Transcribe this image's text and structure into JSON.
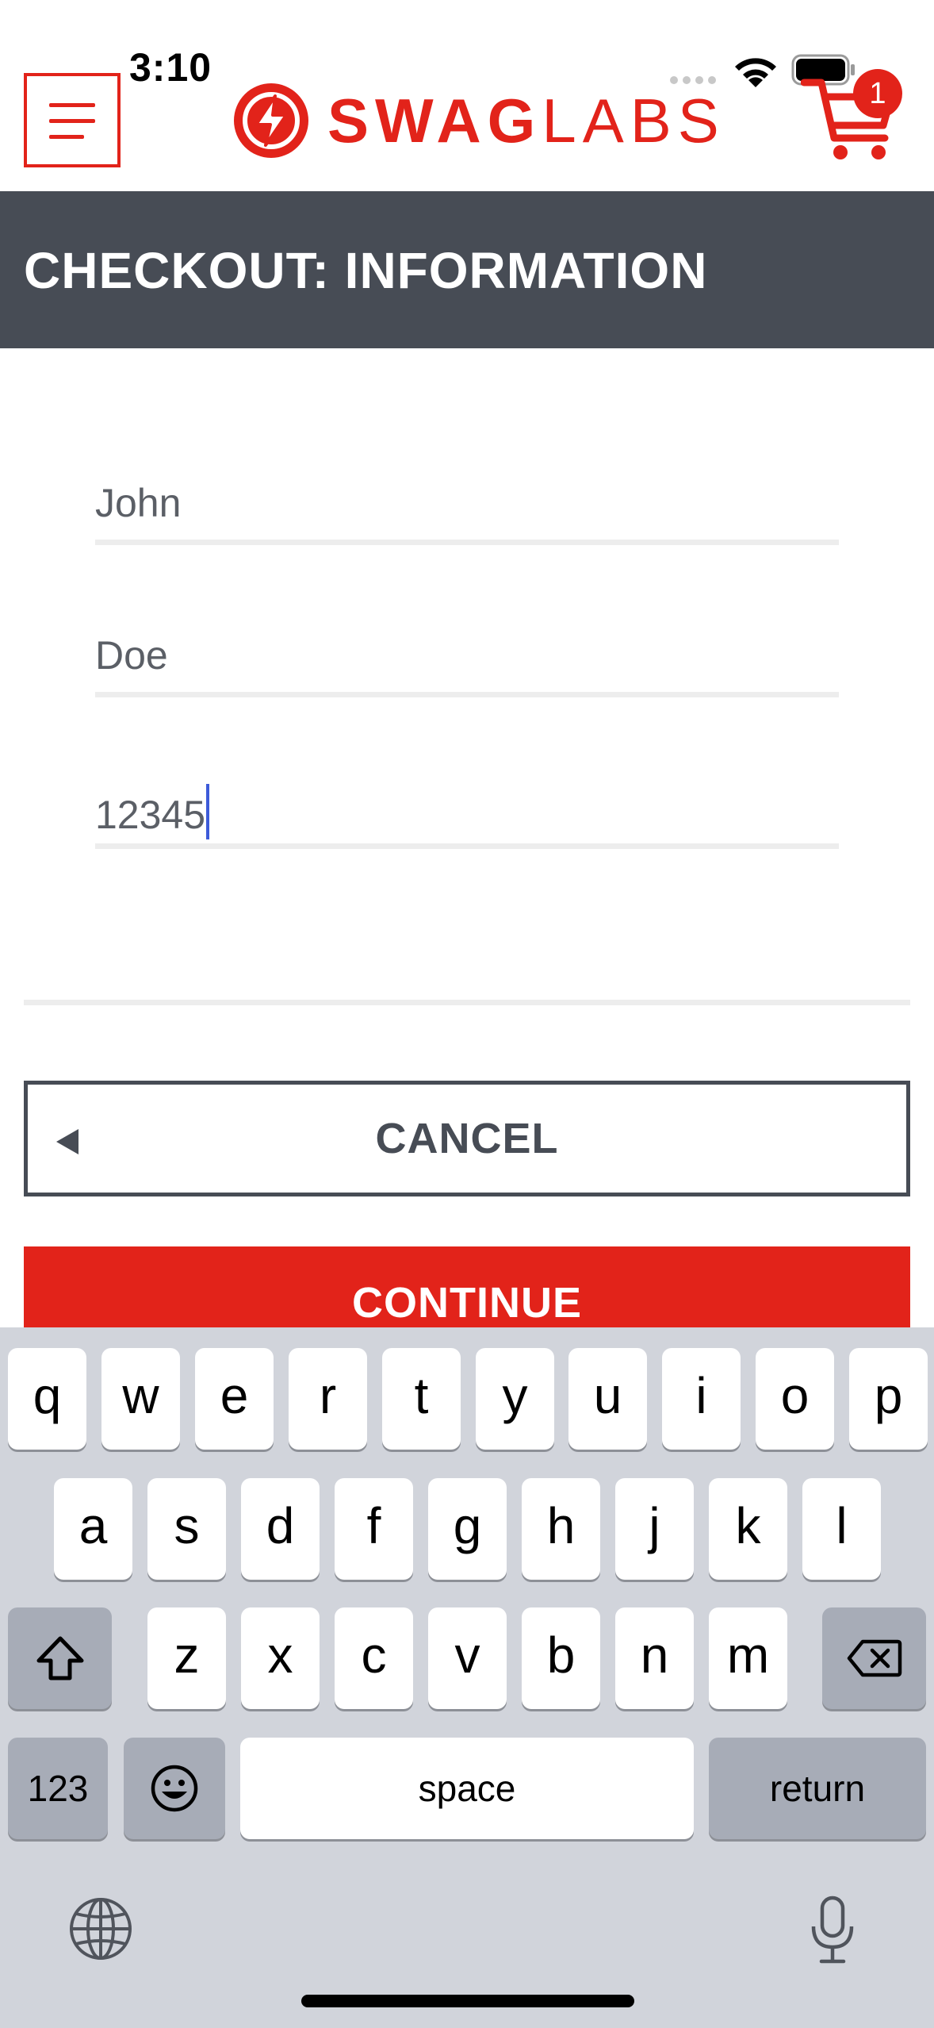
{
  "status_bar": {
    "time": "3:10"
  },
  "header": {
    "brand_part1": "SWAG",
    "brand_part2": "LABS",
    "cart_count": "1"
  },
  "title": "CHECKOUT: INFORMATION",
  "form": {
    "first_name": "John",
    "last_name": "Doe",
    "postal_code": "12345"
  },
  "buttons": {
    "cancel": "CANCEL",
    "continue": "CONTINUE"
  },
  "keyboard": {
    "row1": [
      "q",
      "w",
      "e",
      "r",
      "t",
      "y",
      "u",
      "i",
      "o",
      "p"
    ],
    "row2": [
      "a",
      "s",
      "d",
      "f",
      "g",
      "h",
      "j",
      "k",
      "l"
    ],
    "row3": [
      "z",
      "x",
      "c",
      "v",
      "b",
      "n",
      "m"
    ],
    "numbers_key": "123",
    "space_key": "space",
    "return_key": "return"
  },
  "colors": {
    "brand_red": "#e2231a",
    "title_bar": "#474c55",
    "keyboard_bg": "#d1d4db"
  }
}
